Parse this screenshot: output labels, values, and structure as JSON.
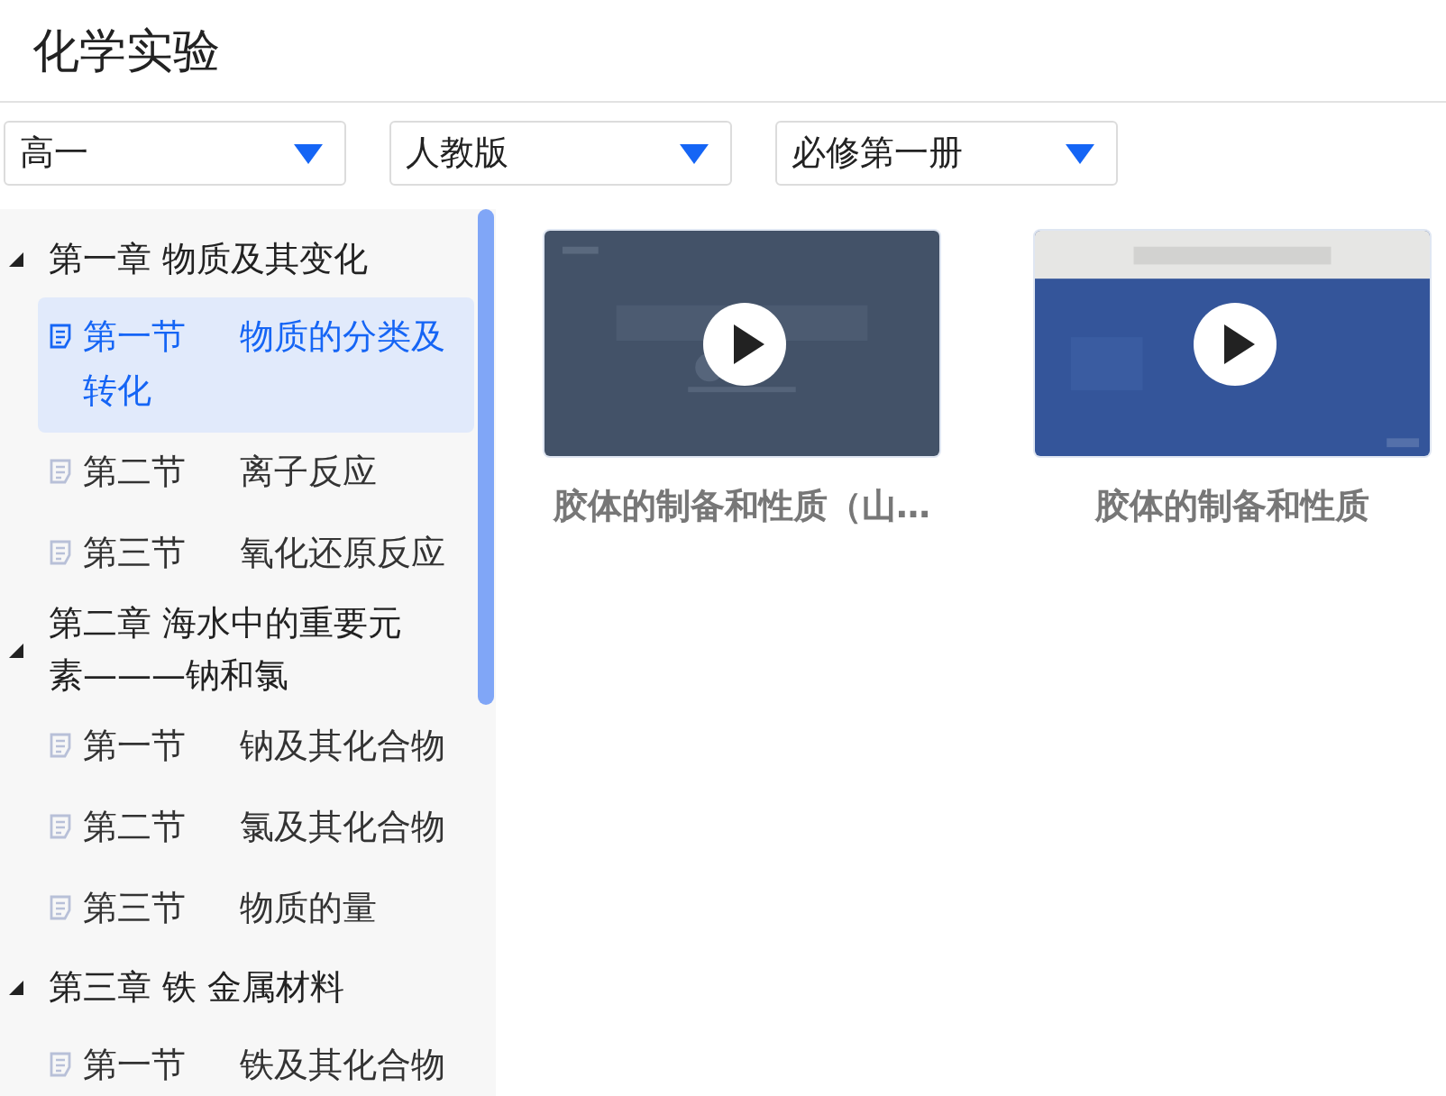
{
  "title": "化学实验",
  "filters": [
    {
      "value": "高一"
    },
    {
      "value": "人教版"
    },
    {
      "value": "必修第一册"
    }
  ],
  "tree": [
    {
      "label": "第一章  物质及其变化",
      "expanded": true,
      "children": [
        {
          "number": "第一节",
          "title": "物质的分类及转化",
          "selected": true
        },
        {
          "number": "第二节",
          "title": "离子反应",
          "selected": false
        },
        {
          "number": "第三节",
          "title": "氧化还原反应",
          "selected": false
        }
      ]
    },
    {
      "label": "第二章  海水中的重要元素———钠和氯",
      "expanded": true,
      "children": [
        {
          "number": "第一节",
          "title": "钠及其化合物",
          "selected": false
        },
        {
          "number": "第二节",
          "title": "氯及其化合物",
          "selected": false
        },
        {
          "number": "第三节",
          "title": "物质的量",
          "selected": false
        }
      ]
    },
    {
      "label": "第三章  铁  金属材料",
      "expanded": true,
      "children": [
        {
          "number": "第一节",
          "title": "铁及其化合物",
          "selected": false
        }
      ]
    }
  ],
  "videos": [
    {
      "caption": "胶体的制备和性质（山…",
      "kind": "dark"
    },
    {
      "caption": "胶体的制备和性质",
      "kind": "banner"
    }
  ]
}
